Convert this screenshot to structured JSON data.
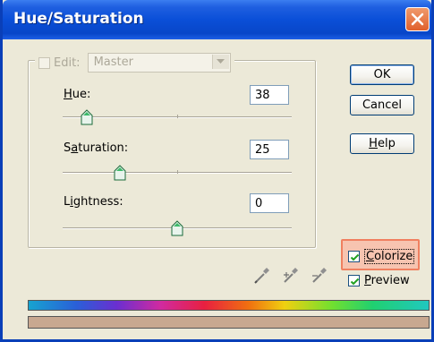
{
  "window": {
    "title": "Hue/Saturation"
  },
  "edit": {
    "label": "Edit:",
    "value": "Master"
  },
  "hue": {
    "label": "Hue:",
    "value": "38",
    "slider_fraction": 0.11
  },
  "saturation": {
    "label": "Saturation:",
    "value": "25",
    "slider_fraction": 0.26
  },
  "lightness": {
    "label": "Lightness:",
    "value": "0",
    "slider_fraction": 0.5
  },
  "buttons": {
    "ok": "OK",
    "cancel": "Cancel",
    "help": "Help"
  },
  "options": {
    "colorize_label": "Colorize",
    "colorize_checked": true,
    "preview_label": "Preview",
    "preview_checked": true
  },
  "colors": {
    "titlebar": "#0a4fd8",
    "highlight": "#f08060",
    "result_color": "#c8a890"
  },
  "icons": [
    "close-icon",
    "eyedropper-icon",
    "eyedropper-plus-icon",
    "eyedropper-minus-icon",
    "checkmark-icon",
    "chevron-down-icon"
  ]
}
